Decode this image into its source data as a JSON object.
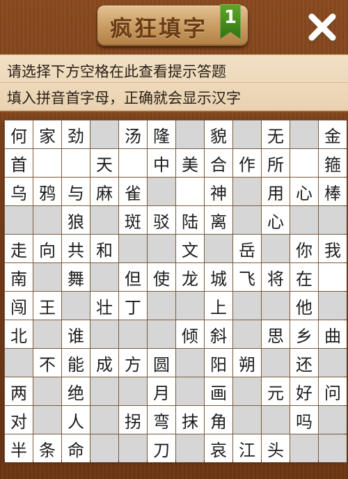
{
  "header": {
    "title": "疯狂填字",
    "level": "1",
    "close_icon": "close-icon"
  },
  "hints": {
    "line1": "请选择下方空格在此查看提示答题",
    "line2": "填入拼音首字母，正确就会显示汉字"
  },
  "colors": {
    "background_wood": "#7a3f18",
    "plaque": "#c89a60",
    "ribbon_green": "#3f8a18",
    "cell_white": "#ffffff",
    "cell_blocked": "#d6d6d6"
  },
  "board": {
    "rows": [
      [
        "何",
        "家",
        "劲",
        null,
        "汤",
        "隆",
        null,
        "貌",
        null,
        "无",
        null,
        "金"
      ],
      [
        "首",
        "",
        "",
        "天",
        "",
        "中",
        "美",
        "合",
        "作",
        "所",
        "",
        "箍"
      ],
      [
        "乌",
        "鸦",
        "与",
        "麻",
        "雀",
        null,
        "",
        "神",
        null,
        "用",
        "心",
        "棒"
      ],
      [
        null,
        null,
        "狼",
        null,
        "斑",
        "驳",
        "陆",
        "离",
        null,
        "心",
        null,
        null
      ],
      [
        "走",
        "向",
        "共",
        "和",
        null,
        null,
        "文",
        null,
        "岳",
        null,
        "你",
        "我"
      ],
      [
        "南",
        null,
        "舞",
        null,
        "但",
        "使",
        "龙",
        "城",
        "飞",
        "将",
        "在",
        ""
      ],
      [
        "闯",
        "王",
        null,
        "壮",
        "丁",
        null,
        null,
        "上",
        null,
        null,
        "他",
        null
      ],
      [
        "北",
        null,
        "谁",
        null,
        null,
        null,
        "倾",
        "斜",
        null,
        "思",
        "乡",
        "曲"
      ],
      [
        null,
        "不",
        "能",
        "成",
        "方",
        "圆",
        null,
        "阳",
        "朔",
        null,
        "还",
        null
      ],
      [
        "两",
        null,
        "绝",
        null,
        null,
        "月",
        null,
        "画",
        null,
        "元",
        "好",
        "问"
      ],
      [
        "对",
        null,
        "人",
        null,
        "拐",
        "弯",
        "抹",
        "角",
        null,
        null,
        "吗",
        null
      ],
      [
        "半",
        "条",
        "命",
        null,
        null,
        "刀",
        null,
        "哀",
        "江",
        "头",
        null,
        null
      ]
    ]
  }
}
